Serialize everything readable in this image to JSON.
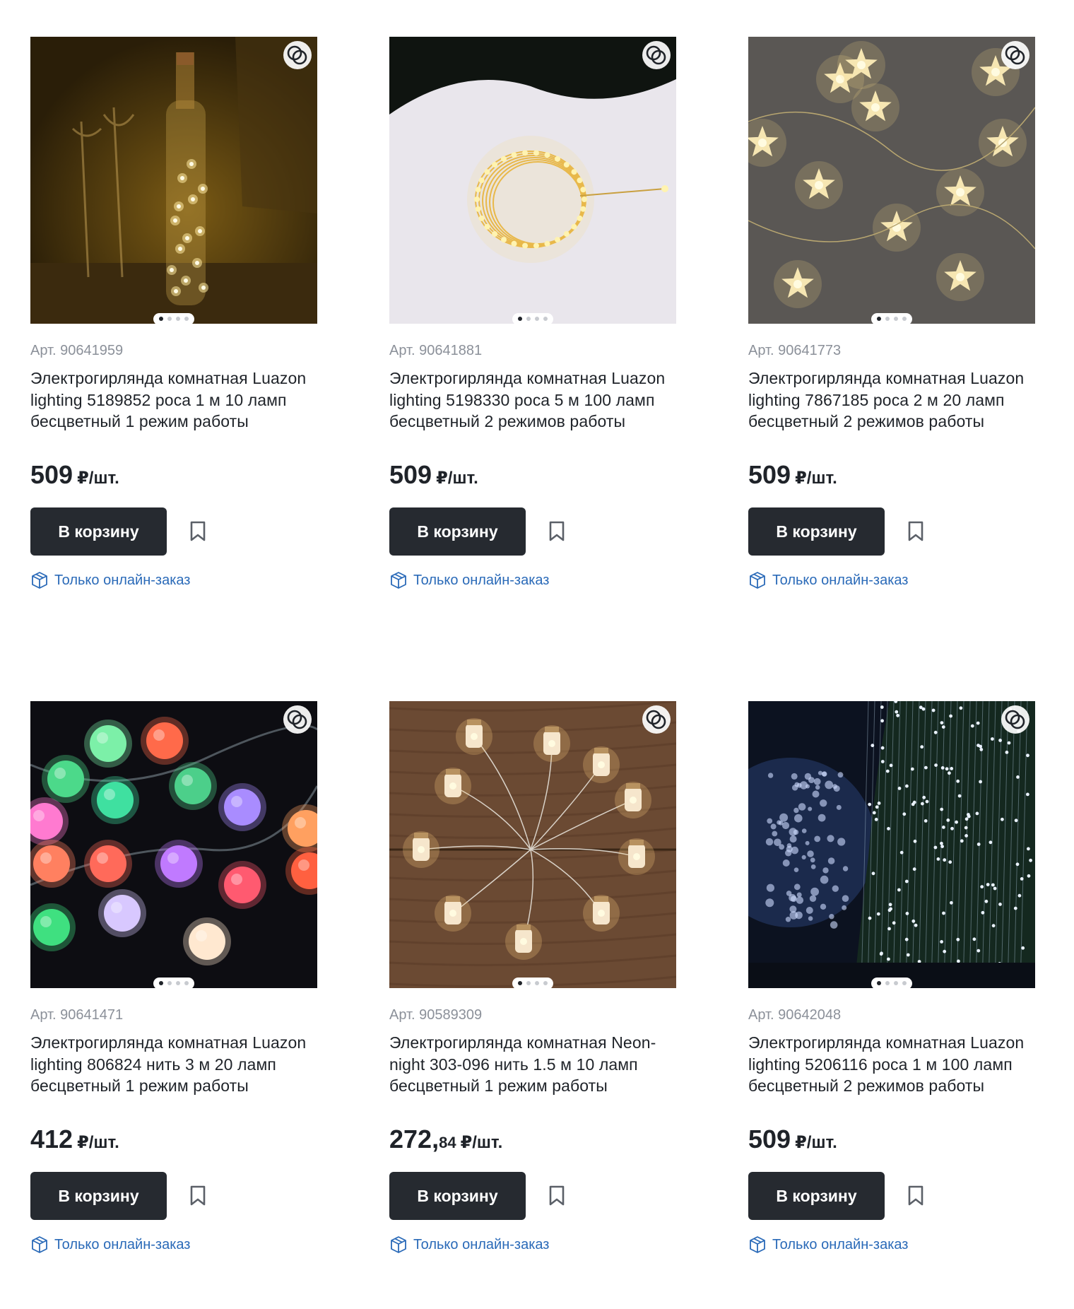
{
  "products": [
    {
      "article": "Арт. 90641959",
      "title": "Электрогирлянда комнатная Luazon lighting 5189852 роса 1 м 10 ламп бесцветный 1 режим работы",
      "price_int": "509",
      "price_frac": "",
      "price_unit": "₽/шт.",
      "cart_label": "В корзину",
      "online_label": "Только онлайн-заказ",
      "image": "bottle-fairy-lights",
      "slides": 4,
      "active_slide": 1
    },
    {
      "article": "Арт. 90641881",
      "title": "Электрогирлянда комнатная Luazon lighting 5198330 роса 5 м 100 ламп бесцветный 2 режимов работы",
      "price_int": "509",
      "price_frac": "",
      "price_unit": "₽/шт.",
      "cart_label": "В корзину",
      "online_label": "Только онлайн-заказ",
      "image": "coiled-wire-lights",
      "slides": 4,
      "active_slide": 1
    },
    {
      "article": "Арт. 90641773",
      "title": "Электрогирлянда комнатная Luazon lighting 7867185 роса 2 м 20 ламп бесцветный 2 режимов работы",
      "price_int": "509",
      "price_frac": "",
      "price_unit": "₽/шт.",
      "cart_label": "В корзину",
      "online_label": "Только онлайн-заказ",
      "image": "star-lights",
      "slides": 4,
      "active_slide": 1
    },
    {
      "article": "Арт. 90641471",
      "title": "Электрогирлянда комнатная Luazon lighting 806824 нить 3 м 20 ламп бесцветный 1 режим работы",
      "price_int": "412",
      "price_frac": "",
      "price_unit": "₽/шт.",
      "cart_label": "В корзину",
      "online_label": "Только онлайн-заказ",
      "image": "colored-ball-lights",
      "slides": 4,
      "active_slide": 1
    },
    {
      "article": "Арт. 90589309",
      "title": "Электрогирлянда комнатная Neon-night 303-096 нить 1.5 м 10 ламп бесцветный 1 режим работы",
      "price_int": "272,",
      "price_frac": "84",
      "price_unit": "₽/шт.",
      "cart_label": "В корзину",
      "online_label": "Только онлайн-заказ",
      "image": "jar-lights-on-wood",
      "slides": 4,
      "active_slide": 1
    },
    {
      "article": "Арт. 90642048",
      "title": "Электрогирлянда комнатная Luazon lighting 5206116 роса 1 м 100 ламп бесцветный 2 режимов работы",
      "price_int": "509",
      "price_frac": "",
      "price_unit": "₽/шт.",
      "cart_label": "В корзину",
      "online_label": "Только онлайн-заказ",
      "image": "cool-white-tree-lights",
      "slides": 4,
      "active_slide": 1
    }
  ],
  "icons": {
    "compare": "compare-rings-icon",
    "favorite": "bookmark-icon",
    "online": "package-box-icon"
  },
  "colors": {
    "button_bg": "#262a30",
    "link": "#2a6ab8",
    "muted": "#8b9099"
  }
}
